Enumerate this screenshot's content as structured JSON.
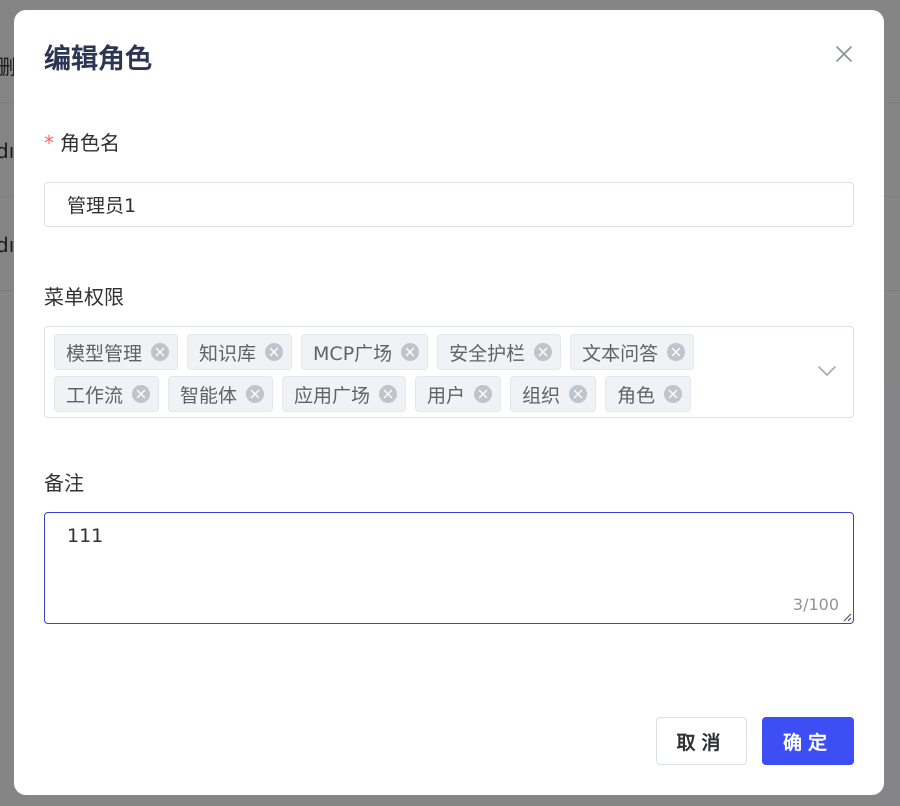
{
  "background": {
    "row_fragments": [
      "删刻",
      "dı",
      "dı"
    ]
  },
  "dialog": {
    "title": "编辑角色",
    "close_icon": "close-icon"
  },
  "form": {
    "role_name": {
      "required_mark": "*",
      "label": "角色名",
      "value": "管理员1"
    },
    "menu_permissions": {
      "label": "菜单权限",
      "tags": [
        {
          "label": "模型管理"
        },
        {
          "label": "知识库"
        },
        {
          "label": "MCP广场"
        },
        {
          "label": "安全护栏"
        },
        {
          "label": "文本问答"
        },
        {
          "label": "工作流"
        },
        {
          "label": "智能体"
        },
        {
          "label": "应用广场"
        },
        {
          "label": "用户"
        },
        {
          "label": "组织"
        },
        {
          "label": "角色"
        }
      ],
      "dropdown_icon": "chevron-down-icon"
    },
    "remark": {
      "label": "备注",
      "value": "111",
      "count": "3/100"
    }
  },
  "footer": {
    "cancel_label": "取消",
    "confirm_label": "确定"
  },
  "colors": {
    "primary": "#3d4ef5",
    "title": "#2c3554",
    "required": "#f56c6c",
    "focus_border": "#3b42c4"
  }
}
